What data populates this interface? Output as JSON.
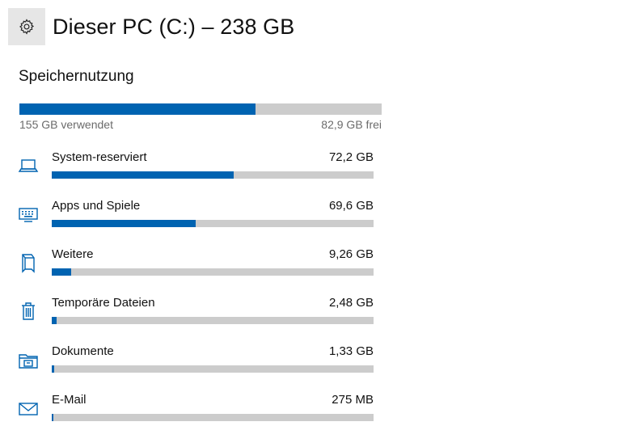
{
  "header": {
    "title": "Dieser PC (C:) – 238 GB",
    "settings_icon": "gear-icon"
  },
  "storage": {
    "section_title": "Speichernutzung",
    "used_text": "155 GB verwendet",
    "free_text": "82,9 GB frei",
    "used_fraction": 0.652
  },
  "categories": [
    {
      "label": "System-reserviert",
      "size": "72,2 GB",
      "icon": "laptop-icon",
      "fraction": 0.565
    },
    {
      "label": "Apps und Spiele",
      "size": "69,6 GB",
      "icon": "keyboard-icon",
      "fraction": 0.447
    },
    {
      "label": "Weitere",
      "size": "9,26 GB",
      "icon": "folder-icon",
      "fraction": 0.06
    },
    {
      "label": "Temporäre Dateien",
      "size": "2,48 GB",
      "icon": "trash-icon",
      "fraction": 0.016
    },
    {
      "label": "Dokumente",
      "size": "1,33 GB",
      "icon": "documents-icon",
      "fraction": 0.008
    },
    {
      "label": "E-Mail",
      "size": "275 MB",
      "icon": "mail-icon",
      "fraction": 0.003
    }
  ],
  "colors": {
    "accent": "#0063b1",
    "bar_track": "#cccccc",
    "icon": "#0063b1"
  }
}
